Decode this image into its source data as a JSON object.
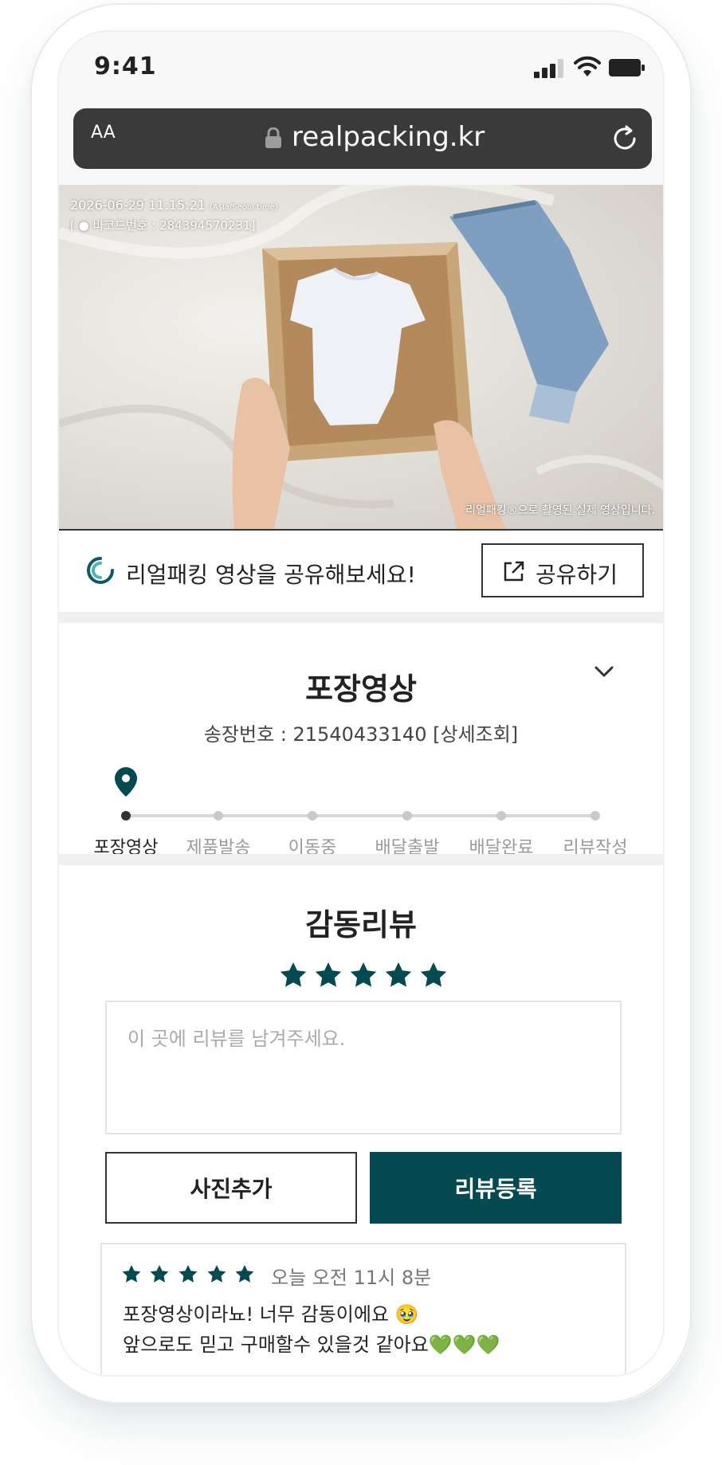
{
  "status_bar": {
    "time": "9:41"
  },
  "browser": {
    "text_size": "AA",
    "url": "realpacking.kr"
  },
  "video": {
    "timestamp": "2026-06-29 11:15:21",
    "timezone": "(Asia/Seoul time)",
    "barcode": "[ ● 바코드번호 : 284394570231]",
    "caption": "리얼패킹®으로 촬영된 실제 영상입니다."
  },
  "share": {
    "text": "리얼패킹 영상을 공유해보세요!",
    "button_label": "공유하기"
  },
  "packing": {
    "title": "포장영상",
    "invoice": "송장번호 : 21540433140 [상세조회]",
    "steps": [
      "포장영상",
      "제품발송",
      "이동중",
      "배달출발",
      "배달완료",
      "리뷰작성"
    ],
    "active_step": 0
  },
  "review": {
    "title": "감동리뷰",
    "rating": 5,
    "placeholder": "이 곳에 리뷰를 남겨주세요.",
    "photo_button": "사진추가",
    "submit_button": "리뷰등록",
    "latest": {
      "rating": 5,
      "time": "오늘 오전 11시 8분",
      "line1": "포장영상이라뇨! 너무 감동이에요 🥹",
      "line2": "앞으로도 믿고 구매할수 있을것 같아요💚💚💚"
    }
  },
  "colors": {
    "accent": "#054a51",
    "divider": "#f0f0f0"
  }
}
